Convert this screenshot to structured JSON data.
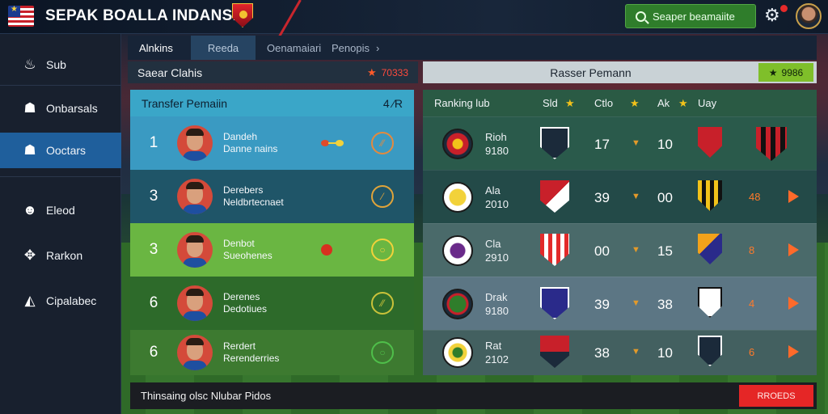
{
  "header": {
    "title": "SEPAK BOALLA INDANSIA",
    "search_label": "Seaper beamaiite"
  },
  "sidebar": {
    "items": [
      {
        "label": "Sub",
        "icon": "flame-icon"
      },
      {
        "label": "Onbarsals",
        "icon": "user-icon"
      },
      {
        "label": "Ooctars",
        "icon": "users-icon",
        "active": true
      },
      {
        "label": "Eleod",
        "icon": "person-icon"
      },
      {
        "label": "Rarkon",
        "icon": "ranking-icon"
      },
      {
        "label": "Cipalabec",
        "icon": "shield-icon"
      }
    ]
  },
  "tabs": [
    {
      "label": "Alnkins"
    },
    {
      "label": "Reeda"
    },
    {
      "label": "Oenamaiari"
    },
    {
      "label": "Penopis",
      "suffix": "›"
    }
  ],
  "left_header": {
    "label": "Saear Clahis",
    "value": "70333"
  },
  "right_header": {
    "label": "Rasser Pemann",
    "badge": "9986"
  },
  "transfer": {
    "title": "Transfer Pemaiin",
    "count": "4",
    "count_suffix": "⁄R",
    "players": [
      {
        "rank": "1",
        "name1": "Dandeh",
        "name2": "Danne nains",
        "ring": "⁄⁄"
      },
      {
        "rank": "3",
        "name1": "Derebers",
        "name2": "Neldbrtecnaet",
        "ring": "⁄"
      },
      {
        "rank": "3",
        "name1": "Denbot",
        "name2": "Sueohenes",
        "ring": "○"
      },
      {
        "rank": "6",
        "name1": "Derenes",
        "name2": "Dedotiues",
        "ring": "⁄⁄"
      },
      {
        "rank": "6",
        "name1": "Rerdert",
        "name2": "Rerenderries",
        "ring": "○"
      }
    ]
  },
  "ranking": {
    "headers": {
      "club": "Ranking lub",
      "c1": "Sld",
      "c2": "Ctlo",
      "c3": "Ak",
      "c4": "Uay"
    },
    "rows": [
      {
        "club1": "Rioh",
        "club2": "9180",
        "stat1": "17",
        "stat2": "10",
        "extra": "",
        "club_color": "#c8202a",
        "shield1": "#1b2a3a",
        "shield2": "#c8202a"
      },
      {
        "club1": "Ala",
        "club2": "2010",
        "stat1": "39",
        "stat2": "00",
        "extra": "48",
        "club_color": "#f2d23a",
        "shield1": "#c8202a",
        "shield2": "#f2c21a"
      },
      {
        "club1": "Cla",
        "club2": "2910",
        "stat1": "00",
        "stat2": "15",
        "extra": "8",
        "club_color": "#6a2a8a",
        "shield1": "#e22a2a",
        "shield2": "#f2a21a"
      },
      {
        "club1": "Drak",
        "club2": "9180",
        "stat1": "39",
        "stat2": "38",
        "extra": "4",
        "club_color": "#2f7d2b",
        "shield1": "#2a2a8a",
        "shield2": "#ffffff"
      },
      {
        "club1": "Rat",
        "club2": "2102",
        "stat1": "38",
        "stat2": "10",
        "extra": "6",
        "club_color": "#f2d23a",
        "shield1": "#c8202a",
        "shield2": "#1b2a3a"
      }
    ]
  },
  "bottom": {
    "text": "Thinsaing olsc Nlubar Pidos",
    "button": "RROEDS"
  }
}
